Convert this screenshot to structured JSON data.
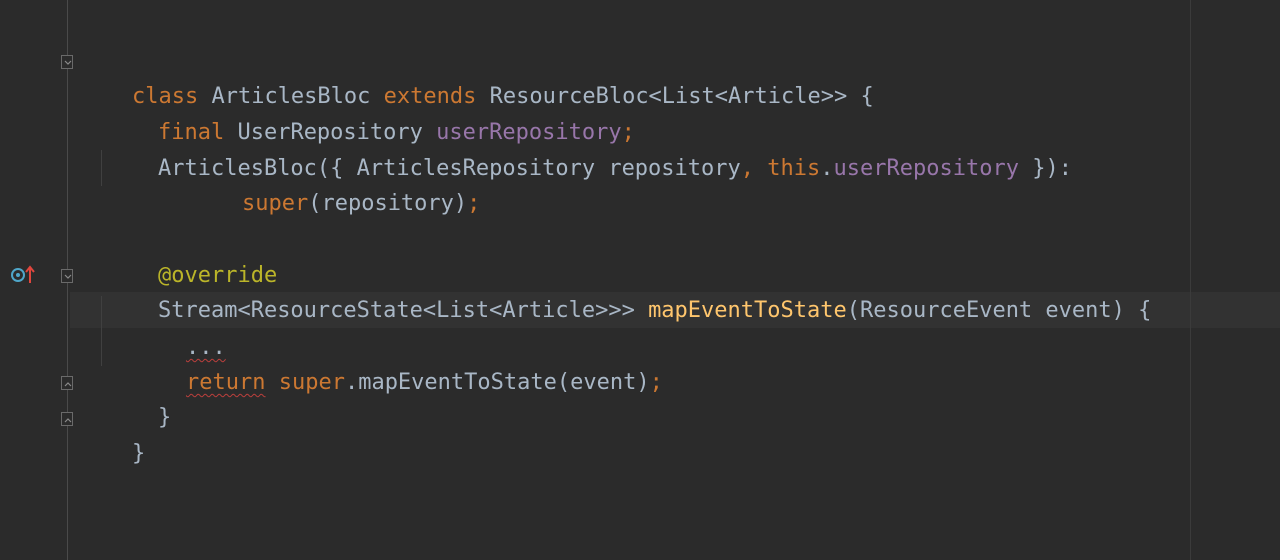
{
  "editor": {
    "language": "Dart",
    "lines": {
      "top_partial": [
        "",
        "",
        ""
      ],
      "class_decl": [
        "class",
        " ArticlesBloc ",
        "extends",
        " ResourceBloc<List<Article>> {"
      ],
      "field_decl": [
        "final",
        " UserRepository ",
        "userRepository",
        ";"
      ],
      "ctor_decl": [
        "ArticlesBloc({ ArticlesRepository repository",
        ",",
        " ",
        "this",
        ".",
        "userRepository",
        " }):"
      ],
      "super_call": [
        "super",
        "(repository)",
        ";"
      ],
      "annotation": [
        "@",
        "override"
      ],
      "method_decl": [
        "Stream<ResourceState<List<Article>>> ",
        "mapEventToState",
        "(ResourceEvent event) {"
      ],
      "ellipsis": [
        "..."
      ],
      "return_line": [
        "return",
        " ",
        "super",
        ".mapEventToState(event)",
        ";"
      ],
      "method_close": [
        "}"
      ],
      "class_close": [
        "}"
      ]
    },
    "gutter_icons": {
      "override_marker": "overrides-method-icon"
    },
    "colors": {
      "background": "#2b2b2b",
      "keyword": "#cc7832",
      "field": "#9876aa",
      "function": "#ffc66d",
      "annotation": "#bbb529",
      "text": "#a9b7c6",
      "current_line": "#323232"
    }
  }
}
